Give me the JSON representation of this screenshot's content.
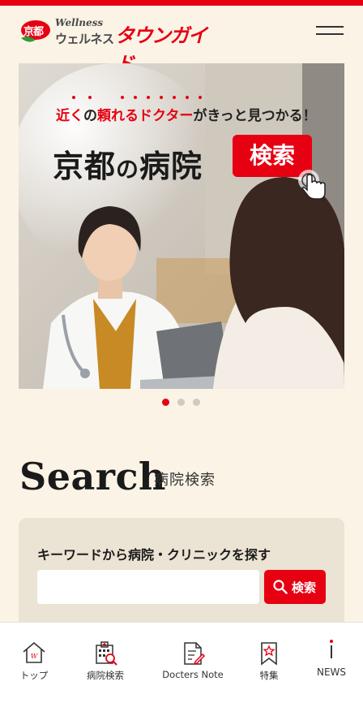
{
  "header": {
    "logo_badge": "京都",
    "logo_wellness": "Wellness",
    "logo_sub": "ウェルネス",
    "logo_main": "タウンガイド"
  },
  "hero": {
    "catch_part1": "近く",
    "catch_part2": "の",
    "catch_part3": "頼れるドクター",
    "catch_part4": "がきっと見つかる！",
    "title_part1": "京都",
    "title_part2": "の",
    "title_part3": "病院",
    "search_label": "検索"
  },
  "carousel": {
    "total": 3,
    "active": 1
  },
  "search": {
    "heading": "Search",
    "subheading": "病院検索",
    "box_title": "キーワードから病院・クリニックを探す",
    "input_value": "",
    "input_placeholder": "",
    "button_label": "検索"
  },
  "bottom_nav": {
    "items": [
      {
        "label": "トップ",
        "icon": "home-icon"
      },
      {
        "label": "病院検索",
        "icon": "hospital-search-icon"
      },
      {
        "label": "Docters Note",
        "icon": "note-icon"
      },
      {
        "label": "特集",
        "icon": "bookmark-star-icon"
      },
      {
        "label": "NEWS",
        "icon": "info-icon"
      }
    ]
  },
  "colors": {
    "accent": "#e60012",
    "background": "#faf3e6",
    "search_box": "#ebe3d3"
  }
}
